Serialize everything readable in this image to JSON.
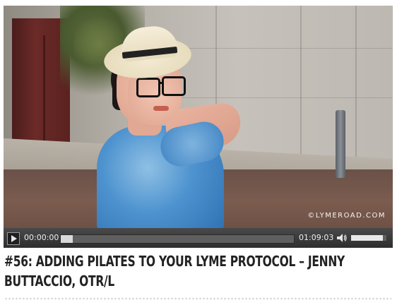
{
  "player": {
    "current_time": "00:00:00",
    "duration": "01:09:03",
    "progress_fraction": 0.05,
    "volume_fraction": 0.9,
    "play_icon": "play-icon",
    "volume_icon": "speaker-icon",
    "watermark": "©LYMEROAD.COM"
  },
  "post": {
    "title": "#56: Adding Pilates to Your Lyme Protocol – Jenny Buttaccio, OTR/L"
  },
  "colors": {
    "control_bar": "#3a3a3a",
    "title_text": "#222222"
  }
}
